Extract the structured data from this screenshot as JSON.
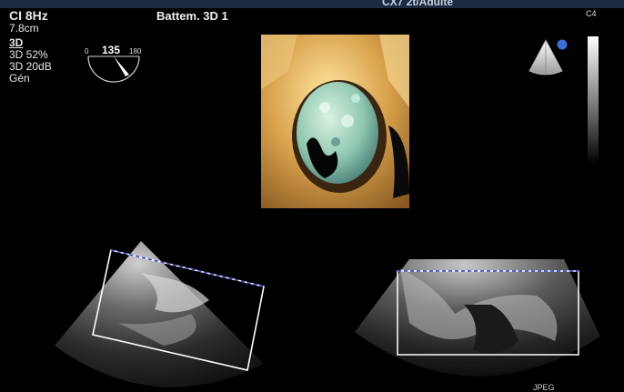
{
  "header": {
    "banner_text": "CX7 2t/Adulte"
  },
  "params": {
    "line1": "CI 8Hz",
    "line2": "7.8cm",
    "mode": "3D",
    "gain": "3D 52%",
    "dynamic": "3D 20dB",
    "preset": "Gén"
  },
  "title": "Battem. 3D 1",
  "angle": {
    "value": "135",
    "min": "0",
    "max": "180",
    "fraction": 0.75
  },
  "probe": {
    "label": "C4"
  },
  "footer": {
    "format": "JPEG"
  },
  "colors": {
    "bar": "#1c2a40",
    "marker": "#3a6fd8",
    "text": "#e6e6e6"
  }
}
